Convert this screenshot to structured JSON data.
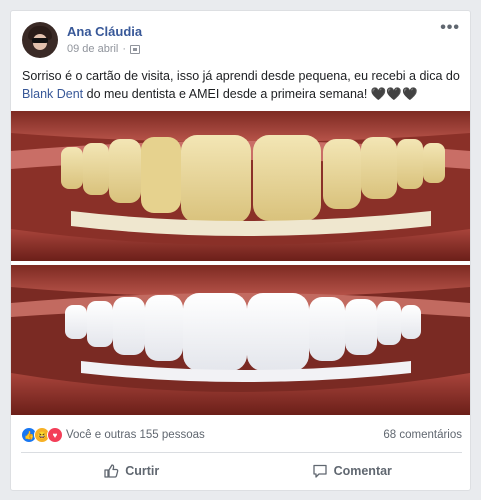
{
  "post": {
    "author_name": "Ana Cláudia",
    "date": "09 de abril",
    "separator": "·",
    "more_menu": "•••",
    "text_part1": "Sorriso é o cartão de visita, isso já aprendi desde pequena, eu recebi a dica do ",
    "link_text": "Blank Dent",
    "text_part2": " do meu dentista e AMEI desde a primeira semana! ",
    "hearts": "🖤🖤🖤",
    "reactions_text": "Você e outras 155 pessoas",
    "comments_count": "68 comentários",
    "actions": [
      {
        "label": "Curtir",
        "icon": "like-icon"
      },
      {
        "label": "Comentar",
        "icon": "comment-icon"
      }
    ]
  },
  "colors": {
    "author": "#385898",
    "link": "#385898",
    "muted": "#90949c",
    "like_blue": "#1877f2",
    "love_red": "#f33e58",
    "haha_yellow": "#f7b125"
  },
  "icons": {
    "reactions": [
      "like-reaction-icon",
      "haha-reaction-icon",
      "love-reaction-icon"
    ],
    "privacy": "public-icon"
  }
}
